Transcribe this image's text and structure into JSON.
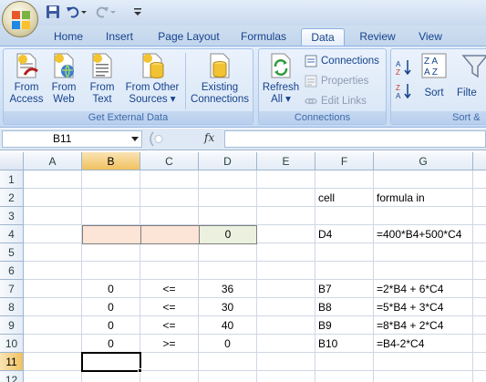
{
  "quick_access": {
    "icons": [
      "save-icon",
      "undo-icon",
      "redo-icon",
      "customize-icon"
    ]
  },
  "tabs": [
    "Home",
    "Insert",
    "Page Layout",
    "Formulas",
    "Data",
    "Review",
    "View"
  ],
  "active_tab": "Data",
  "ribbon": {
    "get_external_data": {
      "label": "Get External Data",
      "buttons": {
        "from_access": [
          "From",
          "Access"
        ],
        "from_web": [
          "From",
          "Web"
        ],
        "from_text": [
          "From",
          "Text"
        ],
        "from_other": [
          "From Other",
          "Sources ▾"
        ],
        "existing": [
          "Existing",
          "Connections"
        ]
      }
    },
    "connections": {
      "label": "Connections",
      "refresh": [
        "Refresh",
        "All ▾"
      ],
      "connections_btn": "Connections",
      "properties_btn": "Properties",
      "edit_links_btn": "Edit Links"
    },
    "sort_filter": {
      "label": "Sort &",
      "sort": "Sort",
      "filter": "Filte"
    }
  },
  "formula_bar": {
    "name_box": "B11",
    "fx": "fx",
    "content": ""
  },
  "grid": {
    "columns": [
      "A",
      "B",
      "C",
      "D",
      "E",
      "F",
      "G"
    ],
    "rows": [
      "1",
      "2",
      "3",
      "4",
      "5",
      "6",
      "7",
      "8",
      "9",
      "10",
      "11",
      "12"
    ],
    "selected_cell": "B11",
    "cells": {
      "F2": "cell",
      "G2": "formula in",
      "D4": "0",
      "F4": "D4",
      "G4": "=400*B4+500*C4",
      "B7": "0",
      "C7": "<=",
      "D7": "36",
      "F7": "B7",
      "G7": "=2*B4 + 6*C4",
      "B8": "0",
      "C8": "<=",
      "D8": "30",
      "F8": "B8",
      "G8": "=5*B4 + 3*C4",
      "B9": "0",
      "C9": "<=",
      "D9": "40",
      "F9": "B9",
      "G9": "=8*B4 + 2*C4",
      "B10": "0",
      "C10": ">=",
      "D10": "0",
      "F10": "B10",
      "G10": "=B4-2*C4"
    }
  },
  "colors": {
    "ribbon_text": "#15428b",
    "peach_fill": "#fce4d6",
    "green_fill": "#ebf1de",
    "header_selected": "#f1c15f"
  }
}
